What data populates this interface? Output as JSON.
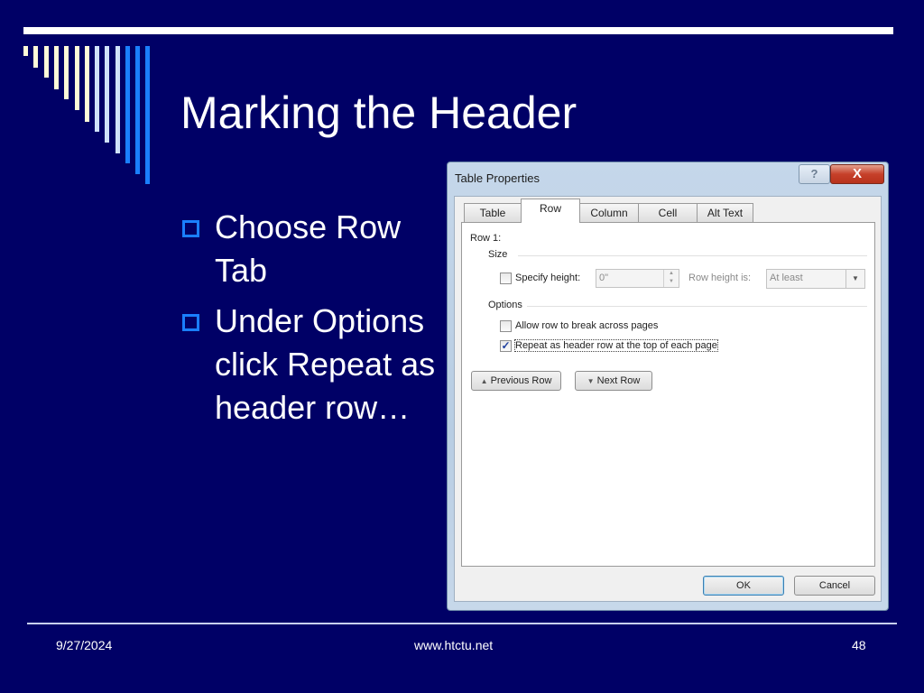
{
  "slide": {
    "title": "Marking the Header",
    "bullets": [
      "Choose Row Tab",
      "Under Options click Repeat as header row…"
    ],
    "footer": {
      "date": "9/27/2024",
      "url": "www.htctu.net",
      "page_number": "48"
    },
    "colors": {
      "background": "#000066",
      "bullet_accent": "#1a7fff",
      "stripe_light": "#fffbd8",
      "stripe_pale_blue": "#cfe2fb",
      "stripe_blue": "#1a7fff"
    }
  },
  "dialog": {
    "title": "Table Properties",
    "help_label": "?",
    "close_label": "X",
    "tabs": [
      {
        "label": "Table",
        "active": false
      },
      {
        "label": "Row",
        "active": true
      },
      {
        "label": "Column",
        "active": false
      },
      {
        "label": "Cell",
        "active": false
      },
      {
        "label": "Alt Text",
        "active": false
      }
    ],
    "row_label": "Row 1:",
    "size_group": "Size",
    "specify_height_label": "Specify height:",
    "specify_height_checked": false,
    "height_value": "0\"",
    "row_height_is_label": "Row height is:",
    "row_height_is_value": "At least",
    "options_group": "Options",
    "options": [
      {
        "label": "Allow row to break across pages",
        "checked": false
      },
      {
        "label": "Repeat as header row at the top of each page",
        "checked": true
      }
    ],
    "previous_row_label": "Previous Row",
    "next_row_label": "Next Row",
    "ok_label": "OK",
    "cancel_label": "Cancel"
  }
}
